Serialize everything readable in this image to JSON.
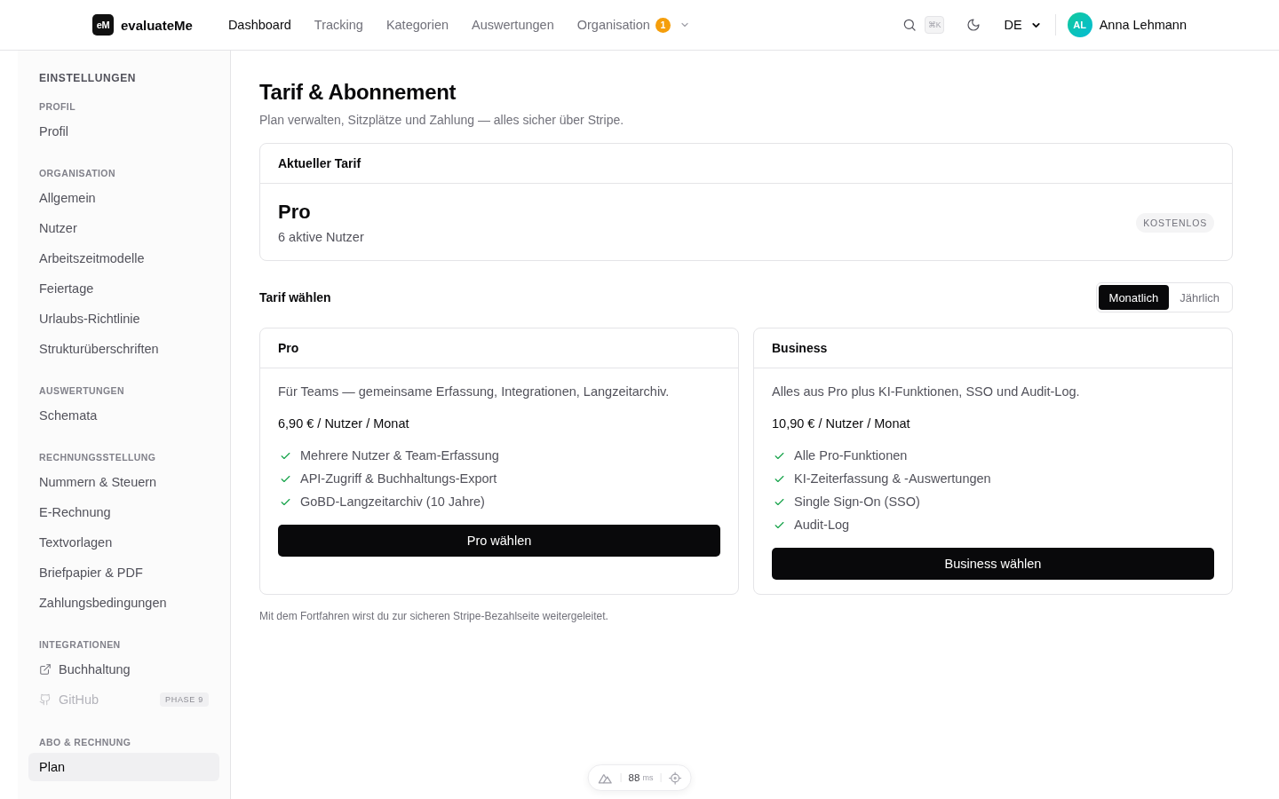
{
  "header": {
    "logo": {
      "mark": "eM",
      "name": "evaluateMe"
    },
    "nav": [
      {
        "label": "Dashboard",
        "selected": true,
        "has_menu": false
      },
      {
        "label": "Tracking",
        "selected": false,
        "has_menu": false
      },
      {
        "label": "Kategorien",
        "selected": false,
        "has_menu": false
      },
      {
        "label": "Auswertungen",
        "selected": false,
        "has_menu": false
      },
      {
        "label": "Organisation",
        "selected": false,
        "has_menu": true,
        "badge": "1"
      }
    ],
    "shortcut": "⌘K",
    "language": "DE",
    "user": {
      "initials": "AL",
      "name": "Anna Lehmann"
    }
  },
  "sidebar": {
    "title": "EINSTELLUNGEN",
    "groups": [
      {
        "title": "PROFIL",
        "items": [
          {
            "label": "Profil",
            "kind": "page",
            "selected": false
          }
        ]
      },
      {
        "title": "ORGANISATION",
        "items": [
          {
            "label": "Allgemein",
            "kind": "page",
            "selected": false
          },
          {
            "label": "Nutzer",
            "kind": "page",
            "selected": false
          },
          {
            "label": "Arbeitszeitmodelle",
            "kind": "page",
            "selected": false
          },
          {
            "label": "Feiertage",
            "kind": "page",
            "selected": false
          },
          {
            "label": "Urlaubs-Richtlinie",
            "kind": "page",
            "selected": false
          },
          {
            "label": "Strukturüberschriften",
            "kind": "page",
            "selected": false
          }
        ]
      },
      {
        "title": "AUSWERTUNGEN",
        "items": [
          {
            "label": "Schemata",
            "kind": "page",
            "selected": false
          }
        ]
      },
      {
        "title": "RECHNUNGSSTELLUNG",
        "items": [
          {
            "label": "Nummern & Steuern",
            "kind": "page",
            "selected": false
          },
          {
            "label": "E-Rechnung",
            "kind": "page",
            "selected": false
          },
          {
            "label": "Textvorlagen",
            "kind": "page",
            "selected": false
          },
          {
            "label": "Briefpapier & PDF",
            "kind": "page",
            "selected": false
          },
          {
            "label": "Zahlungsbedingungen",
            "kind": "page",
            "selected": false
          }
        ]
      },
      {
        "title": "INTEGRATIONEN",
        "items": [
          {
            "label": "Buchhaltung",
            "kind": "external",
            "selected": false,
            "disabled": false
          },
          {
            "label": "GitHub",
            "kind": "repository",
            "selected": false,
            "disabled": true,
            "badge": "PHASE 9"
          }
        ]
      },
      {
        "title": "ABO & RECHNUNG",
        "items": [
          {
            "label": "Plan",
            "kind": "page",
            "selected": true
          }
        ]
      }
    ]
  },
  "page": {
    "title": "Tarif & Abonnement",
    "subtitle": "Plan verwalten, Sitzplätze und Zahlung — alles sicher über Stripe."
  },
  "current_plan": {
    "heading": "Aktueller Tarif",
    "name": "Pro",
    "users": "6 aktive Nutzer",
    "badge": "KOSTENLOS"
  },
  "plan_choice": {
    "heading": "Tarif wählen",
    "billing": [
      {
        "label": "Monatlich",
        "selected": true
      },
      {
        "label": "Jährlich",
        "selected": false
      }
    ],
    "plans": [
      {
        "name": "Pro",
        "description": "Für Teams — gemeinsame Erfassung, Integrationen, Langzeitarchiv.",
        "price": "6,90 € / Nutzer / Monat",
        "features": [
          "Mehrere Nutzer & Team-Erfassung",
          "API-Zugriff & Buchhaltungs-Export",
          "GoBD-Langzeitarchiv (10 Jahre)"
        ],
        "button": "Pro wählen"
      },
      {
        "name": "Business",
        "description": "Alles aus Pro plus KI-Funktionen, SSO und Audit-Log.",
        "price": "10,90 € / Nutzer / Monat",
        "features": [
          "Alle Pro-Funktionen",
          "KI-Zeiterfassung & -Auswertungen",
          "Single Sign-On (SSO)",
          "Audit-Log"
        ],
        "button": "Business wählen"
      }
    ]
  },
  "footnote": "Mit dem Fortfahren wirst du zur sicheren Stripe-Bezahlseite weitergeleitet.",
  "devtools": {
    "timing": "88",
    "unit": "ms"
  }
}
